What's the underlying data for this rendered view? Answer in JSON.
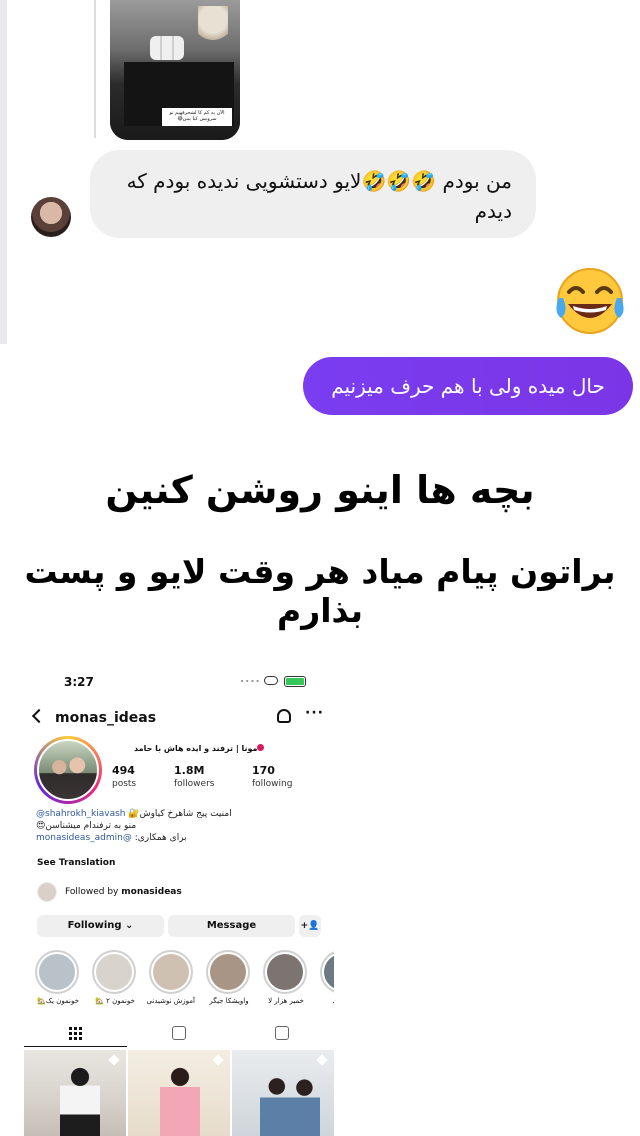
{
  "chat": {
    "shared_post_caption": "الآن یه کم کا لشحرفهیم تو سرویس کیا بینن😅",
    "incoming_message": "من بودم 🤣🤣🤣لایو دستشویی ندیده بودم که دیدم",
    "reaction_emoji": "😂",
    "outgoing_message": "حال میده ولی با هم حرف میزنیم"
  },
  "overlay": {
    "line1": "بچه ها اینو روشن کنین",
    "line2": "براتون پیام میاد هر وقت لایو و پست بذارم"
  },
  "instagram": {
    "status_time": "3:27",
    "status_dots": "....",
    "username": "monas_ideas",
    "more_label": "···",
    "profile_name": "مونا | ترفند و ایده هاش با حامد",
    "stats": [
      {
        "value": "494",
        "label": "posts"
      },
      {
        "value": "1.8M",
        "label": "followers"
      },
      {
        "value": "170",
        "label": "following"
      }
    ],
    "bio_line1_handle": "@shahrokh_kiavash",
    "bio_line1_text": "امنیت پیج شاهرخ کیاوش🔐",
    "bio_line2": "منو به ترفندام میشناسن😍",
    "bio_line3_text": "برای همکاری:",
    "bio_line3_handle": "monasideas_admin@",
    "see_translation": "See Translation",
    "followed_prefix": "Followed by",
    "followed_user": "monasideas",
    "following_button": "Following ⌄",
    "message_button": "Message",
    "add_person_button": "+👤",
    "highlights": [
      {
        "label": "خونمون یک🏡",
        "color": "#b9c2c8"
      },
      {
        "label": "خونمون ۲ 🏡",
        "color": "#d8d3cc"
      },
      {
        "label": "آموزش نوشیدنی",
        "color": "#cfc1b2"
      },
      {
        "label": "واویشکا جیگر",
        "color": "#a99585"
      },
      {
        "label": "خمیر هزار لا",
        "color": "#7b7470"
      },
      {
        "label": "کالب...",
        "color": "#6d7a86"
      }
    ]
  }
}
